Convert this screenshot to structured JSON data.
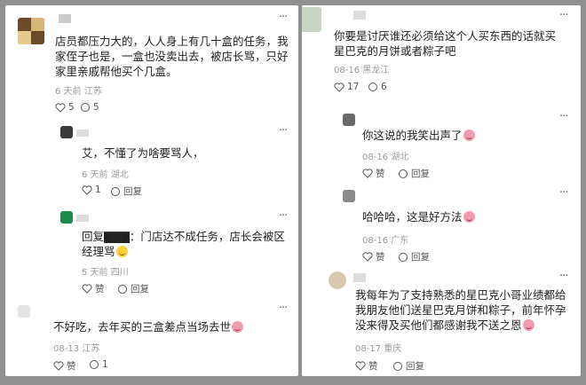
{
  "left": {
    "c1": {
      "text": "店员都压力大的，人人身上有几十盒的任务，我家侄子也是，一盒也没卖出去，被店长骂，只好家里亲戚帮他买个几盒。",
      "meta": "6 天前  江苏",
      "likes": "5",
      "replies": "5"
    },
    "r1": {
      "text": "艾，不懂了为啥要骂人，",
      "meta": "6 天前  湖北",
      "likes": "1",
      "reply_label": "回复"
    },
    "r2": {
      "text": "回复▇▇▇：门店达不成任务，店长会被区经理骂",
      "meta": "5 天前  四川",
      "likes": "赞",
      "reply_label": "回复"
    },
    "c2": {
      "text": "不好吃，去年买的三盒差点当场去世",
      "meta": "08-13  江苏",
      "likes": "赞",
      "replies": "1"
    }
  },
  "right": {
    "c1": {
      "text": "你要是讨厌谁还必须给这个人买东西的话就买星巴克的月饼或者粽子吧",
      "meta": "08-16  黑龙江",
      "likes": "17",
      "replies": "6"
    },
    "r1": {
      "text": "你这说的我笑出声了",
      "meta": "08-16  湖北",
      "likes": "赞",
      "reply_label": "回复"
    },
    "r2": {
      "text": "哈哈哈，这是好方法",
      "meta": "08-16  广东",
      "likes": "赞",
      "reply_label": "回复"
    },
    "c2": {
      "text": "我每年为了支持熟悉的星巴克小哥业绩都给我朋友他们送星巴克月饼和粽子，前年怀孕没来得及买他们都感谢我不送之恩",
      "meta": "08-17  重庆",
      "likes": "赞",
      "reply_label": "回复"
    }
  },
  "icons": [
    "thumb-icon",
    "comment-icon",
    "more-icon",
    "emoji-icon"
  ],
  "colors": {
    "background": "#8f8f8f",
    "panel": "#ffffff",
    "text": "#222222",
    "meta": "#9a9a9a"
  }
}
